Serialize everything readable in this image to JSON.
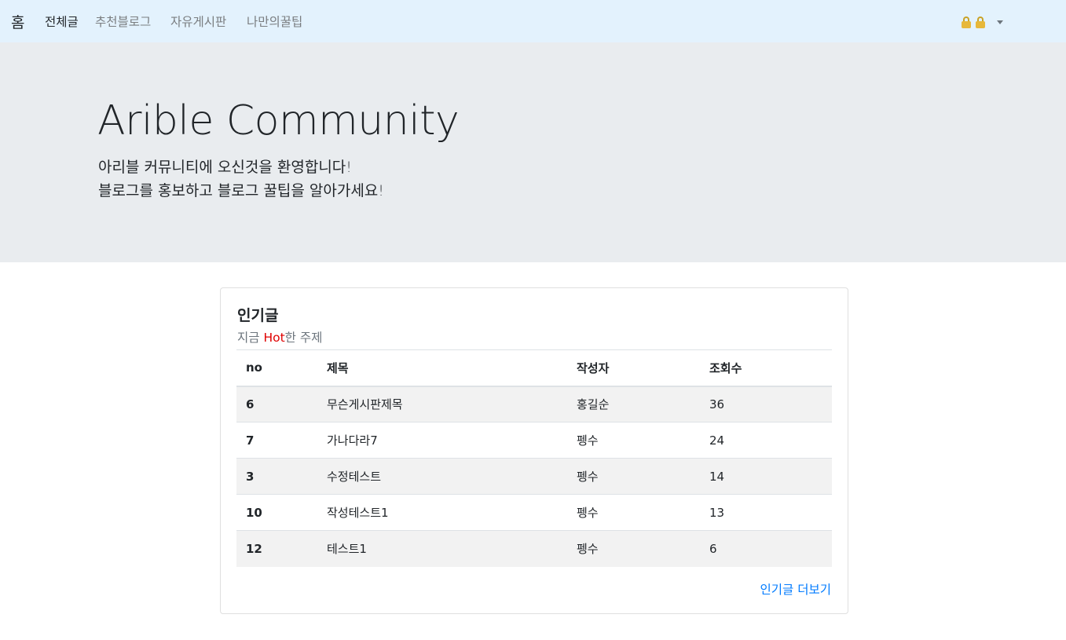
{
  "navbar": {
    "brand": "홈",
    "links": [
      "전체글",
      "추천블로그",
      "자유게시판",
      "나만의꿀팁"
    ],
    "user_icons": [
      "lock-icon",
      "lock-icon"
    ]
  },
  "jumbotron": {
    "title": "Arible Community",
    "line1": "아리블 커뮤니티에 오신것을 환영합니다!",
    "line2": "블로그를 홍보하고 블로그 꿀팁을 알아가세요!"
  },
  "card": {
    "title": "인기글",
    "subtitle_pre": "지금 ",
    "subtitle_hot": "Hot",
    "subtitle_post": "한 주제",
    "columns": [
      "no",
      "제목",
      "작성자",
      "조회수"
    ],
    "rows": [
      {
        "no": "6",
        "title": "무슨게시판제목",
        "author": "홍길순",
        "views": "36"
      },
      {
        "no": "7",
        "title": "가나다라7",
        "author": "펭수",
        "views": "24"
      },
      {
        "no": "3",
        "title": "수정테스트",
        "author": "펭수",
        "views": "14"
      },
      {
        "no": "10",
        "title": "작성테스트1",
        "author": "펭수",
        "views": "13"
      },
      {
        "no": "12",
        "title": "테스트1",
        "author": "펭수",
        "views": "6"
      }
    ],
    "more": "인기글 더보기"
  },
  "colors": {
    "navbar_bg": "#e3f2fd",
    "jumbotron_bg": "#e9ecef",
    "hot": "#e00000",
    "link": "#007bff"
  }
}
